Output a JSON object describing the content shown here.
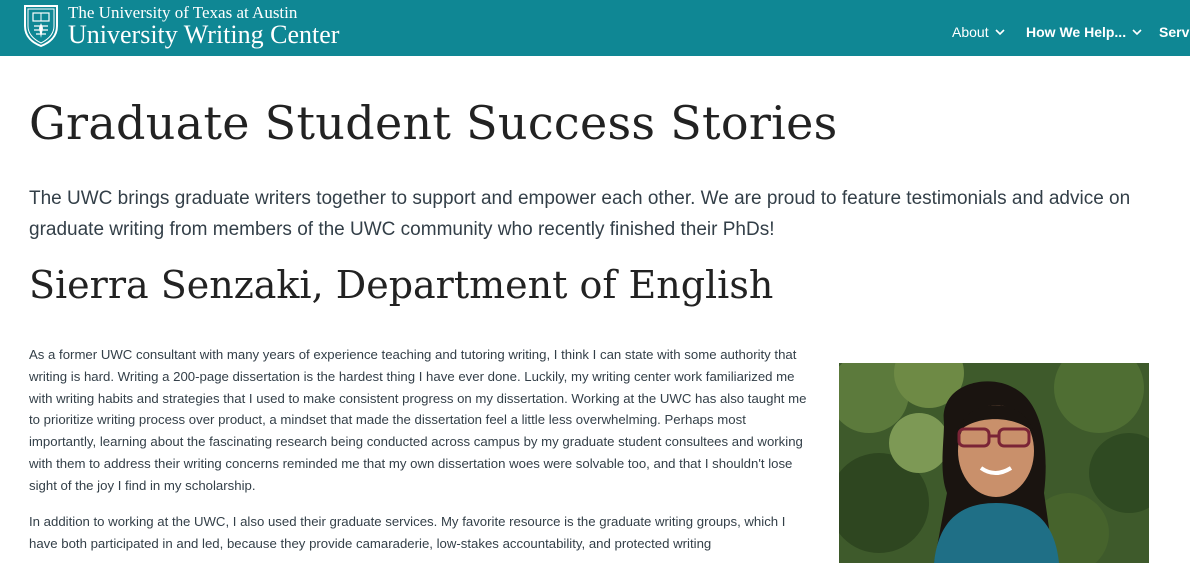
{
  "header": {
    "university": "The University of Texas at Austin",
    "center": "University Writing Center",
    "nav": [
      {
        "label": "About"
      },
      {
        "label": "How We Help..."
      },
      {
        "label": "Servi"
      }
    ]
  },
  "page": {
    "title": "Graduate Student Success Stories",
    "intro": "The UWC brings graduate writers together to support and empower each other. We are proud to feature testimonials and advice on graduate writing from members of the UWC community who recently finished their PhDs!",
    "sections": [
      {
        "heading": "Sierra Senzaki, Department of English",
        "paragraphs": [
          "As a former UWC consultant with many years of experience teaching and tutoring writing, I think I can state with some authority that writing is hard. Writing a 200-page dissertation is the hardest thing I have ever done. Luckily, my writing center work familiarized me with writing habits and strategies that I used to make consistent progress on my dissertation. Working at the UWC has also taught me to prioritize writing process over product, a mindset that made the dissertation feel a little less overwhelming. Perhaps most importantly, learning about the fascinating research being conducted across campus by my graduate student consultees and working with them to address their writing concerns reminded me that my own dissertation woes were solvable too, and that I shouldn't lose sight of the joy I find in my scholarship.",
          "In addition to working at the UWC, I also used their graduate services. My favorite resource is the graduate writing groups, which I have both participated in and led, because they provide camaraderie, low-stakes accountability, and protected writing"
        ]
      }
    ]
  },
  "colors": {
    "header_bg": "#0f8794",
    "text": "#333f48",
    "heading": "#222222"
  },
  "icons": [
    "ut-shield-logo",
    "chevron-down-icon",
    "portrait-photo"
  ]
}
